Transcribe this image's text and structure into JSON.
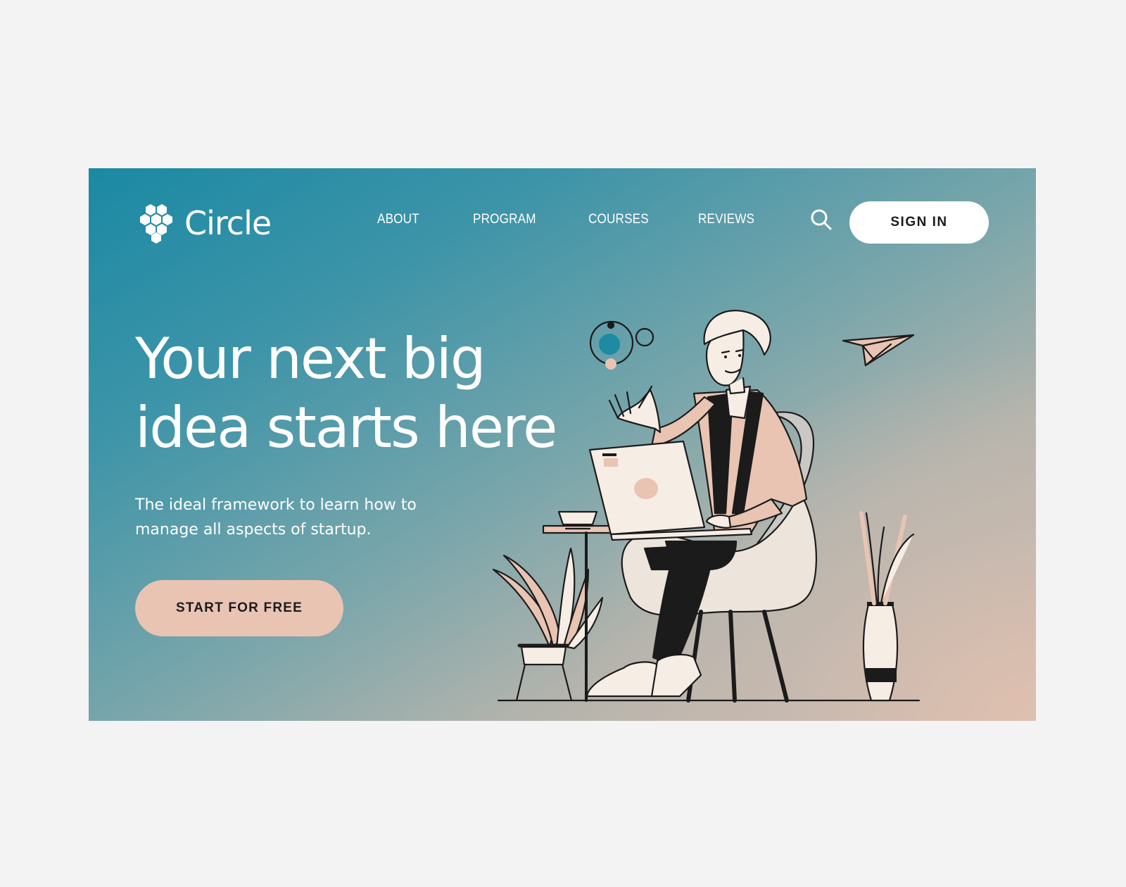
{
  "brand": {
    "name": "Circle",
    "logo_icon": "hexagon-cluster-icon"
  },
  "nav": {
    "items": [
      {
        "label": "ABOUT"
      },
      {
        "label": "PROGRAM"
      },
      {
        "label": "COURSES"
      },
      {
        "label": "REVIEWS"
      }
    ],
    "search_icon": "search-icon",
    "sign_in_label": "SIGN IN"
  },
  "hero": {
    "headline_line1": "Your next big",
    "headline_line2": "idea starts here",
    "subhead_line1": "The ideal framework to learn how to",
    "subhead_line2": "manage all aspects of startup.",
    "cta_label": "START FOR FREE"
  },
  "colors": {
    "gradient_start": "#1b89a4",
    "gradient_end": "#d6bcae",
    "accent_peach": "#e9c4b3",
    "text_light": "#ffffff",
    "text_dark": "#1b1b1b"
  }
}
